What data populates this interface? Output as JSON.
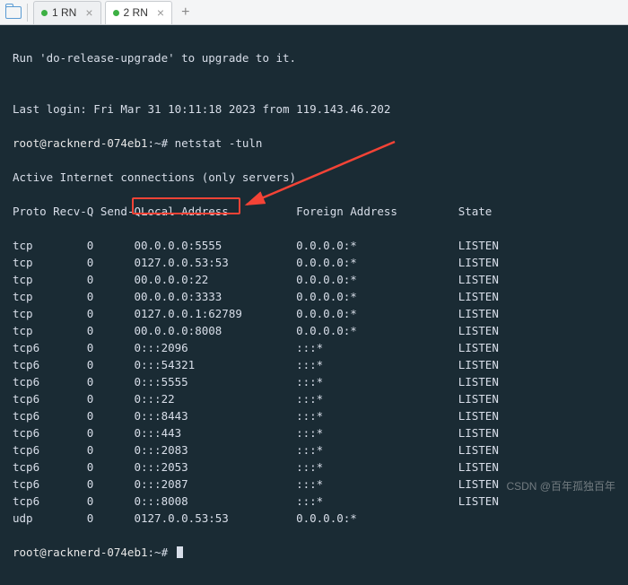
{
  "tabs": [
    {
      "label": "1 RN"
    },
    {
      "label": "2 RN"
    }
  ],
  "add_tab": "+",
  "lines": {
    "upgrade": "Run 'do-release-upgrade' to upgrade to it.",
    "blank": "",
    "lastlogin": "Last login: Fri Mar 31 10:11:18 2023 from 119.143.46.202",
    "prompt1_user": "root@racknerd-074eb1",
    "prompt1_rest": ":~# netstat -tuln",
    "active": "Active Internet connections (only servers)",
    "prompt2_user": "root@racknerd-074eb1",
    "prompt2_rest": ":~# "
  },
  "headers": [
    "Proto",
    "Recv-Q",
    "Send-Q",
    "Local Address",
    "Foreign Address",
    "State"
  ],
  "rows": [
    [
      "tcp",
      "0",
      "0",
      "0.0.0.0:5555",
      "0.0.0.0:*",
      "LISTEN"
    ],
    [
      "tcp",
      "0",
      "0",
      "127.0.0.53:53",
      "0.0.0.0:*",
      "LISTEN"
    ],
    [
      "tcp",
      "0",
      "0",
      "0.0.0.0:22",
      "0.0.0.0:*",
      "LISTEN"
    ],
    [
      "tcp",
      "0",
      "0",
      "0.0.0.0:3333",
      "0.0.0.0:*",
      "LISTEN"
    ],
    [
      "tcp",
      "0",
      "0",
      "127.0.0.1:62789",
      "0.0.0.0:*",
      "LISTEN"
    ],
    [
      "tcp",
      "0",
      "0",
      "0.0.0.0:8008",
      "0.0.0.0:*",
      "LISTEN"
    ],
    [
      "tcp6",
      "0",
      "0",
      ":::2096",
      ":::*",
      "LISTEN"
    ],
    [
      "tcp6",
      "0",
      "0",
      ":::54321",
      ":::*",
      "LISTEN"
    ],
    [
      "tcp6",
      "0",
      "0",
      ":::5555",
      ":::*",
      "LISTEN"
    ],
    [
      "tcp6",
      "0",
      "0",
      ":::22",
      ":::*",
      "LISTEN"
    ],
    [
      "tcp6",
      "0",
      "0",
      ":::8443",
      ":::*",
      "LISTEN"
    ],
    [
      "tcp6",
      "0",
      "0",
      ":::443",
      ":::*",
      "LISTEN"
    ],
    [
      "tcp6",
      "0",
      "0",
      ":::2083",
      ":::*",
      "LISTEN"
    ],
    [
      "tcp6",
      "0",
      "0",
      ":::2053",
      ":::*",
      "LISTEN"
    ],
    [
      "tcp6",
      "0",
      "0",
      ":::2087",
      ":::*",
      "LISTEN"
    ],
    [
      "tcp6",
      "0",
      "0",
      ":::8008",
      ":::*",
      "LISTEN"
    ],
    [
      "udp",
      "0",
      "0",
      "127.0.0.53:53",
      "0.0.0.0:*",
      ""
    ]
  ],
  "watermark": "CSDN @百年孤独百年"
}
